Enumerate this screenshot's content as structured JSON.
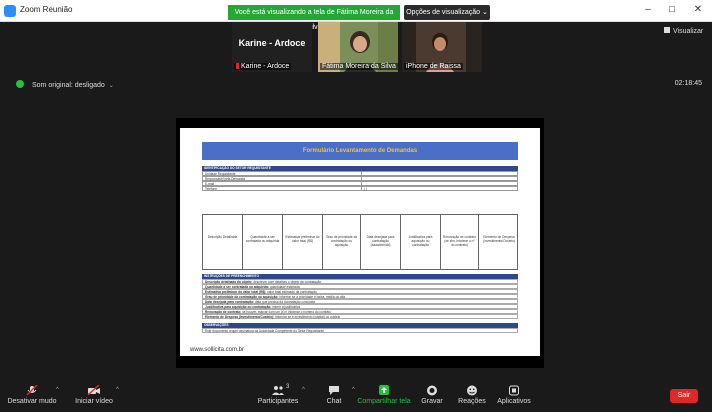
{
  "window": {
    "title": "Zoom Reunião",
    "share_banner": "Você está visualizando a tela de Fátima Moreira da Silva",
    "view_options": "Opções de visualização",
    "view_options_caret": "⌄",
    "controls": {
      "minimize": "–",
      "maximize": "□",
      "close": "✕"
    },
    "visualizar": "Visualizar"
  },
  "participants": [
    {
      "name_display": "Karine - Ardoce",
      "label": "Karine - Ardoce",
      "muted": true,
      "has_video": false
    },
    {
      "label": "Fátima Moreira da Silva",
      "has_video": true,
      "active_speaker": true
    },
    {
      "label": "iPhone de Raissa",
      "has_video": true
    }
  ],
  "audio": {
    "label": "Som original: desligado",
    "caret": "⌄"
  },
  "timer": "02:18:45",
  "shared_doc": {
    "title": "Formulário Levantamento de Demandas",
    "section_identification": "IDENTIFICAÇÃO DO SETOR REQUISITANTE",
    "ident_rows": [
      [
        "Unidade Requisitante",
        ""
      ],
      [
        "Responsável pela Demanda",
        ""
      ],
      [
        "E-mail",
        ""
      ],
      [
        "Telefone",
        "(   )"
      ]
    ],
    "grid_columns": [
      "Descrição Detalhada",
      "Quantidade a ser contratada ou adquirida",
      "Estimativa preliminar do valor total (R$)",
      "Grau de prioridade da contratação ou aquisição",
      "Data desejada para contratação (aaaa/mm/dd)",
      "Justificativa para aquisição ou contratação",
      "Renovação de contrato (se sim, informar o nº do contrato)",
      "Elemento de Despesa (Investimento/Custeio)"
    ],
    "section_instructions": "INSTRUÇÕES DE PREENCHIMENTO",
    "instructions": [
      {
        "bold": "Descrição detalhada do objeto:",
        "text": " descrever com detalhes o objeto da contratação"
      },
      {
        "bold": "Quantidade a ser contratada ou adquirida:",
        "text": " quantidade estimada"
      },
      {
        "bold": "Estimativa preliminar do valor total (R$):",
        "text": " valor total estimado da contratação"
      },
      {
        "bold": "Grau de prioridade da contratação ou aquisição:",
        "text": " informar se a prioridade é baixa, média ou alta"
      },
      {
        "bold": "Data desejada para contratação:",
        "text": " data que precisa da contratação concluída"
      },
      {
        "bold": "Justificativa para aquisição ou contratação:",
        "text": " inserir a justificativa"
      },
      {
        "bold": "Renovação de contrato:",
        "text": " se houver, marcar com um (x) e informar o número do contrato"
      },
      {
        "bold": "Elemento de Despesa (Investimento/Custeio):",
        "text": " informar se é investimento (capital) ou custeio"
      }
    ],
    "section_observations": "OBSERVAÇÕES",
    "observation": "Este documento requer assinatura da Autoridade Competente do Setor Requisitante",
    "site_url": "www.sollicita.com.br"
  },
  "toolbar": {
    "mute": "Desativar mudo",
    "video": "Iniciar vídeo",
    "participants": "Participantes",
    "participants_count": "3",
    "chat": "Chat",
    "share": "Compartilhar tela",
    "record": "Gravar",
    "reactions": "Reações",
    "apps": "Aplicativos",
    "leave": "Sair",
    "caret_up": "^"
  },
  "colors": {
    "share_green": "#23a834",
    "leave_red": "#e02828",
    "doc_header_blue": "#4a6fc6",
    "doc_section_navy": "#2c4a8a"
  }
}
